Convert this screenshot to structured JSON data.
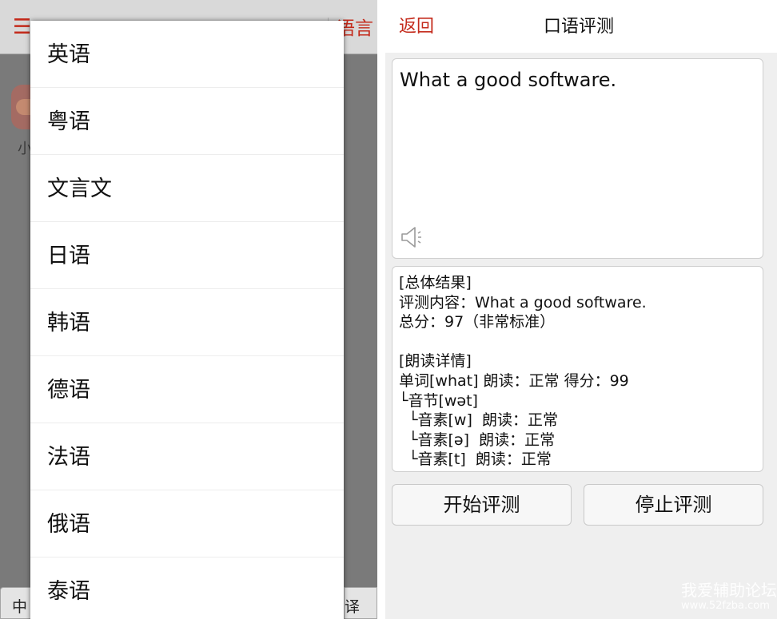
{
  "left_panel": {
    "top_right_label": "语言",
    "avatar_label": "小",
    "bottom_left_label": "中",
    "bottom_right_label": "译",
    "language_options": [
      "英语",
      "粤语",
      "文言文",
      "日语",
      "韩语",
      "德语",
      "法语",
      "俄语",
      "泰语"
    ]
  },
  "right_panel": {
    "back_label": "返回",
    "title": "口语评测",
    "input_text": "What a good software.",
    "result_lines": [
      "[总体结果]",
      "评测内容：What a good software.",
      "总分：97（非常标准）",
      "",
      "[朗读详情]",
      "单词[what] 朗读：正常 得分：99",
      "└音节[wət]",
      "  └音素[w]  朗读：正常",
      "  └音素[ə]  朗读：正常",
      "  └音素[t]  朗读：正常"
    ],
    "start_label": "开始评测",
    "stop_label": "停止评测"
  },
  "watermark": {
    "text": "我爱辅助论坛",
    "url": "www.52fzba.com"
  },
  "icons": {
    "menu": "menu-icon",
    "speaker": "speaker-icon"
  },
  "colors": {
    "accent_red": "#c42b1c",
    "overlay_gray": "#7a7a7a",
    "panel_bg": "#efefef"
  }
}
